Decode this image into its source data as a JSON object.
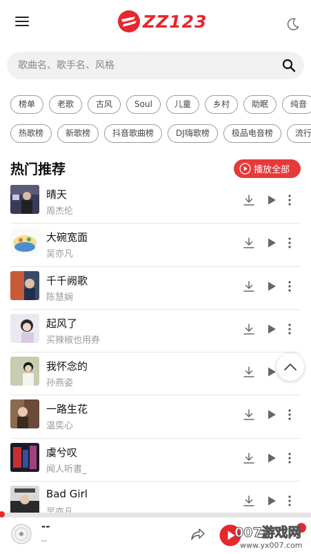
{
  "header": {
    "logo_text": "ZZ123",
    "menu_icon": "hamburger-menu-icon",
    "theme_icon": "moon-icon",
    "brand_color": "#e8262d"
  },
  "search": {
    "placeholder": "歌曲名、歌手名、风格",
    "value": "",
    "icon": "search-icon"
  },
  "genre_tags": [
    "榜单",
    "老歌",
    "古风",
    "Soul",
    "儿童",
    "乡村",
    "助眠",
    "纯音"
  ],
  "chart_tags": [
    "热歌榜",
    "新歌榜",
    "抖音歌曲榜",
    "DJ嗨歌榜",
    "极品电音榜",
    "流行"
  ],
  "section": {
    "title": "热门推荐",
    "play_all_label": "播放全部",
    "play_all_color": "#e63a3a"
  },
  "songs": [
    {
      "title": "晴天",
      "artist": "周杰伦"
    },
    {
      "title": "大碗宽面",
      "artist": "吴亦凡"
    },
    {
      "title": "千千阙歌",
      "artist": "陈慧娴"
    },
    {
      "title": "起风了",
      "artist": "买辣椒也用券"
    },
    {
      "title": "我怀念的",
      "artist": "孙燕姿"
    },
    {
      "title": "一路生花",
      "artist": "温奕心"
    },
    {
      "title": "虞兮叹",
      "artist": "闻人听書_"
    },
    {
      "title": "Bad Girl",
      "artist": "吴亦凡"
    }
  ],
  "song_actions": {
    "download_icon": "download-icon",
    "play_icon": "play-icon",
    "more_icon": "more-vertical-icon"
  },
  "player": {
    "title": "--",
    "artist": "--",
    "progress": 0
  },
  "watermark": {
    "main": "007游戏网",
    "sub": "www.yx007.com"
  }
}
